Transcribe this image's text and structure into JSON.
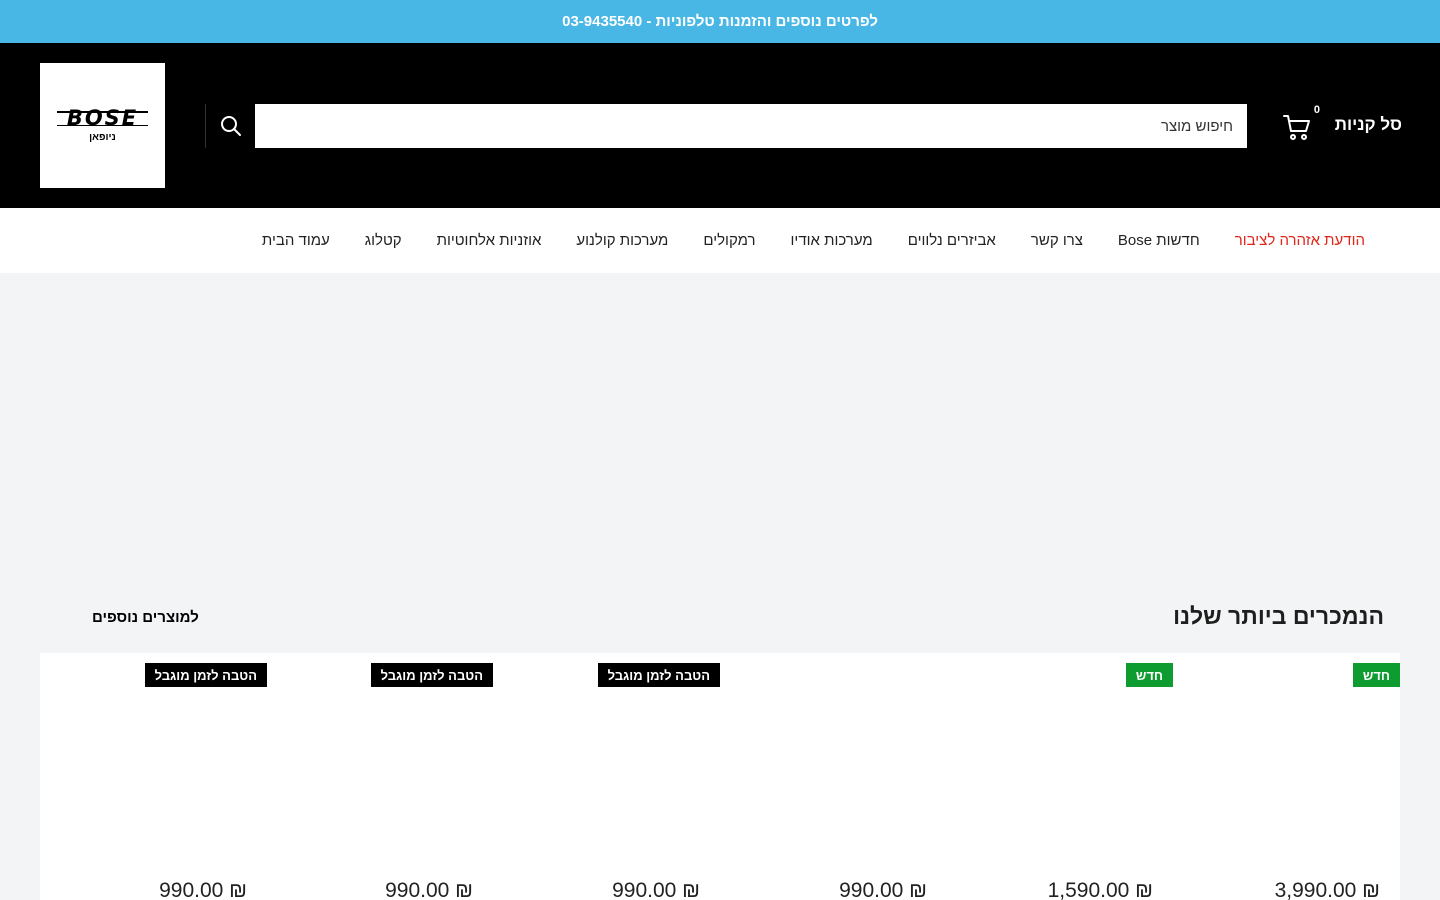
{
  "announcement": {
    "text": "לפרטים נוספים והזמנות טלפוניות - 03-9435540"
  },
  "logo": {
    "wordmark": "BOSE",
    "subtitle": "ניופאן"
  },
  "search": {
    "placeholder": "חיפוש מוצר",
    "value": ""
  },
  "cart": {
    "label": "סל קניות",
    "count": "0"
  },
  "nav": {
    "items": [
      {
        "label": "עמוד הבית"
      },
      {
        "label": "קטלוג"
      },
      {
        "label": "אוזניות אלחוטיות"
      },
      {
        "label": "מערכות קולנוע"
      },
      {
        "label": "רמקולים"
      },
      {
        "label": "מערכות אודיו"
      },
      {
        "label": "אביזרים נלווים"
      },
      {
        "label": "צרו קשר"
      },
      {
        "label": "חדשות Bose"
      },
      {
        "label": "הודעת אזהרה לציבור"
      }
    ]
  },
  "bestsellers": {
    "title": "הנמכרים ביותר שלנו",
    "more_link": "למוצרים נוספים",
    "products": [
      {
        "badge": "חדש",
        "price": "₪ 3,990.00"
      },
      {
        "badge": "חדש",
        "price": "₪ 1,590.00"
      },
      {
        "badge": "",
        "price": "₪ 990.00"
      },
      {
        "badge": "הטבה לזמן מוגבל",
        "price": "₪ 990.00"
      },
      {
        "badge": "הטבה לזמן מוגבל",
        "price": "₪ 990.00"
      },
      {
        "badge": "הטבה לזמן מוגבל",
        "price": "₪ 990.00"
      }
    ]
  },
  "colors": {
    "announcement_bg": "#48b7e5",
    "header_bg": "#000000",
    "alert_link": "#e0251b",
    "badge_new": "#0e9b2f",
    "badge_deal": "#000000"
  }
}
